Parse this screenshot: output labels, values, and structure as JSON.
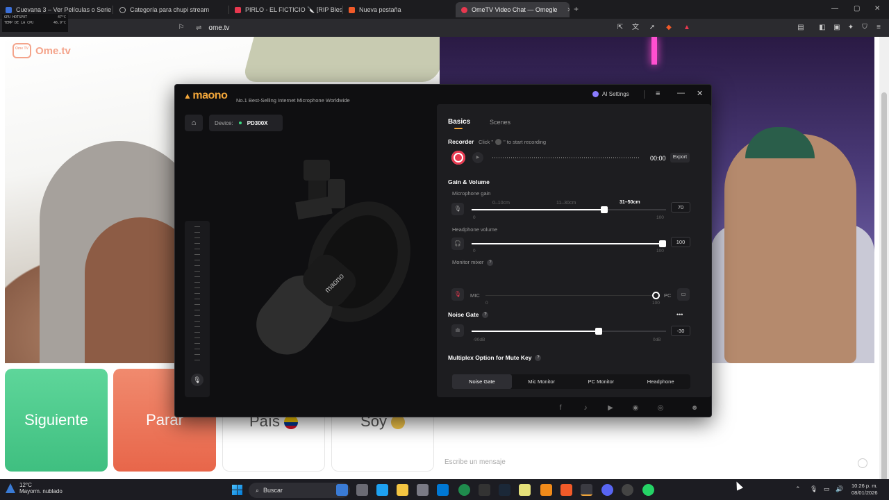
{
  "overlay": {
    "rows": [
      {
        "label": "GPU HOTSPOT",
        "value": "47°C"
      },
      {
        "label": "TEMP DE LA CPU",
        "value": "46.9°C"
      }
    ]
  },
  "tabs": [
    {
      "label": "Cuevana 3 – Ver Películas o Series",
      "fav_color": "#3a6fd8"
    },
    {
      "label": "Categoría para chupi stream",
      "fav_color": "#bbbbbb"
    },
    {
      "label": "PIRLO - EL FICTICIO 🔪 [RIP Blessd]",
      "fav_color": "#e8384f"
    },
    {
      "label": "Nueva pestaña",
      "fav_color": "#f15a29"
    },
    {
      "label": "OmeTV Video Chat — Omegle",
      "fav_color": "#e8384f"
    }
  ],
  "address": {
    "url": "ome.tv"
  },
  "site": {
    "logo_text": "Ome.tv",
    "logo_box": "Ome TV"
  },
  "buttons": {
    "next": "Siguiente",
    "stop": "Parar",
    "country": "País",
    "gender": "Soy"
  },
  "chat": {
    "placeholder": "Escribe un mensaje"
  },
  "maono": {
    "brand": "maono",
    "tagline": "No.1 Best-Selling Internet Microphone Worldwide",
    "ai_settings": "AI Settings",
    "device_label": "Device:",
    "device_name": "PD300X",
    "tabs": {
      "basics": "Basics",
      "scenes": "Scenes"
    },
    "recorder": {
      "title": "Recorder",
      "hint_pre": "Click \"",
      "hint_post": "\" to start recording",
      "time": "00:00",
      "export": "Export"
    },
    "gain": {
      "title": "Gain & Volume",
      "mic_gain_label": "Microphone gain",
      "zones": [
        "0–10cm",
        "11–30cm",
        "31–50cm"
      ],
      "active_zone": "31–50cm",
      "mic_gain_value": "70",
      "mic_gain_fraction": 0.7,
      "mic_min": "0",
      "mic_max": "100",
      "headphone_label": "Headphone volume",
      "headphone_value": "100",
      "headphone_fraction": 1.0,
      "hp_min": "0",
      "hp_max": "100",
      "monitor_label": "Monitor mixer",
      "mix_mic": "MIC",
      "mix_pc": "PC",
      "mix_min": "0",
      "mix_max": "100"
    },
    "noise_gate": {
      "title": "Noise Gate",
      "value": "-30",
      "fraction": 0.67,
      "min": "-90dB",
      "max": "0dB",
      "more": "•••"
    },
    "multiplex": {
      "title": "Multiplex Option for Mute Key",
      "options": [
        "Noise Gate",
        "Mic Monitor",
        "PC Monitor",
        "Headphone"
      ],
      "selected": "Noise Gate"
    }
  },
  "taskbar": {
    "temp": "12°C",
    "weather": "Mayorm. nublado",
    "search": "Buscar",
    "time": "10:26 p. m.",
    "date": "08/01/2026"
  }
}
